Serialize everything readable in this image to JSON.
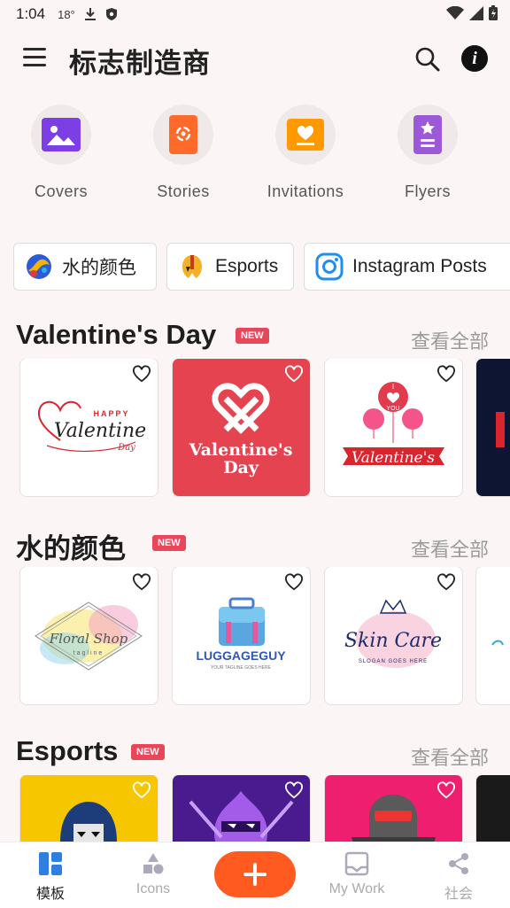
{
  "status_bar": {
    "time": "1:04",
    "temperature": "18°"
  },
  "app_bar": {
    "title": "标志制造商"
  },
  "categories": [
    {
      "label": "Covers",
      "icon": "image-icon",
      "color": "#7b3fe4"
    },
    {
      "label": "Stories",
      "icon": "stories-icon",
      "color": "#ff6a2a"
    },
    {
      "label": "Invitations",
      "icon": "invitation-icon",
      "color": "#ff9900"
    },
    {
      "label": "Flyers",
      "icon": "flyer-icon",
      "color": "#9b59d8"
    }
  ],
  "chips": [
    {
      "label": "水的颜色"
    },
    {
      "label": "Esports"
    },
    {
      "label": "Instagram Posts"
    }
  ],
  "sections": [
    {
      "title": "Valentine's Day",
      "badge": "NEW",
      "see_all": "查看全部",
      "cards": [
        {
          "line1": "HAPPY",
          "line2": "Valentine",
          "line3": "Day"
        },
        {
          "line1": "Valentine's",
          "line2": "Day"
        },
        {
          "line1": "I",
          "line2": "YOU",
          "line3": "Valentine's"
        }
      ]
    },
    {
      "title": "水的颜色",
      "badge": "NEW",
      "see_all": "查看全部",
      "cards": [
        {
          "line1": "Floral Shop",
          "line2": "tagline"
        },
        {
          "line1": "LUGGAGEGUY",
          "line2": "YOUR TAGLINE GOES HERE"
        },
        {
          "line1": "Skin Care",
          "line2": "SLOGAN GOES HERE"
        }
      ]
    },
    {
      "title": "Esports",
      "badge": "NEW",
      "see_all": "查看全部",
      "cards": [
        {},
        {},
        {}
      ]
    }
  ],
  "bottom_nav": [
    {
      "label": "模板",
      "icon": "templates-icon",
      "active": true
    },
    {
      "label": "Icons",
      "icon": "shapes-icon",
      "active": false
    },
    {
      "label": "My Work",
      "icon": "my-work-icon",
      "active": false
    },
    {
      "label": "社会",
      "icon": "share-icon",
      "active": false
    }
  ],
  "colors": {
    "accent": "#ff5a1f",
    "badge": "#e8475a",
    "active_nav": "#2f7fe0"
  }
}
